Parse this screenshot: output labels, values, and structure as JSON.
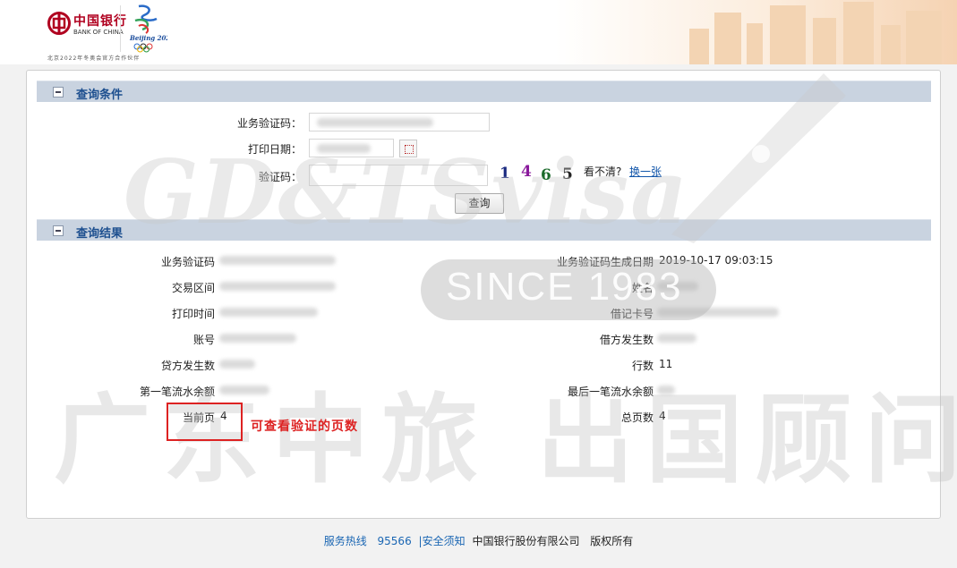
{
  "header": {
    "bank_name_cn": "中国银行",
    "bank_name_en": "BANK OF CHINA",
    "olympics_logo_text": "Beijing 2022",
    "sponsor_text": "北京2022年冬奥会官方合作伙伴"
  },
  "query_section": {
    "title": "查询条件",
    "fields": {
      "business_code_label": "业务验证码：",
      "print_date_label": "打印日期：",
      "captcha_label": "验证码："
    },
    "captcha_chars": [
      "1",
      "4",
      "6",
      "5"
    ],
    "cant_see_text": "看不清?",
    "refresh_link": "换一张",
    "submit_label": "查询"
  },
  "result_section": {
    "title": "查询结果",
    "left": {
      "business_code_label": "业务验证码",
      "range_label": "交易区间",
      "print_time_label": "打印时间",
      "account_label": "账号",
      "credit_count_label": "贷方发生数",
      "first_balance_label": "第一笔流水余额",
      "current_page_label": "当前页",
      "current_page_value": "4"
    },
    "right": {
      "code_date_label": "业务验证码生成日期",
      "code_date_value": "2019-10-17 09:03:15",
      "name_label": "姓名",
      "card_label": "借记卡号",
      "debit_count_label": "借方发生数",
      "rows_label": "行数",
      "rows_value": "11",
      "last_balance_label": "最后一笔流水余额",
      "total_pages_label": "总页数",
      "total_pages_value": "4"
    }
  },
  "watermark": {
    "brand": "GD&TSvisa",
    "since": "SINCE 1983",
    "company_cn": "广东中旅 出国顾问"
  },
  "annotation": {
    "text": "可查看验证的页数"
  },
  "footer": {
    "hotline_label": "服务热线",
    "hotline_number": "95566",
    "separator": "|",
    "security_link": "安全须知",
    "company": "中国银行股份有限公司",
    "copyright": "版权所有"
  },
  "colors": {
    "section_bar": "#c9d3e0",
    "section_title": "#1d4f8f",
    "annotation_red": "#dd2222",
    "footer_link": "#1a66b3"
  }
}
